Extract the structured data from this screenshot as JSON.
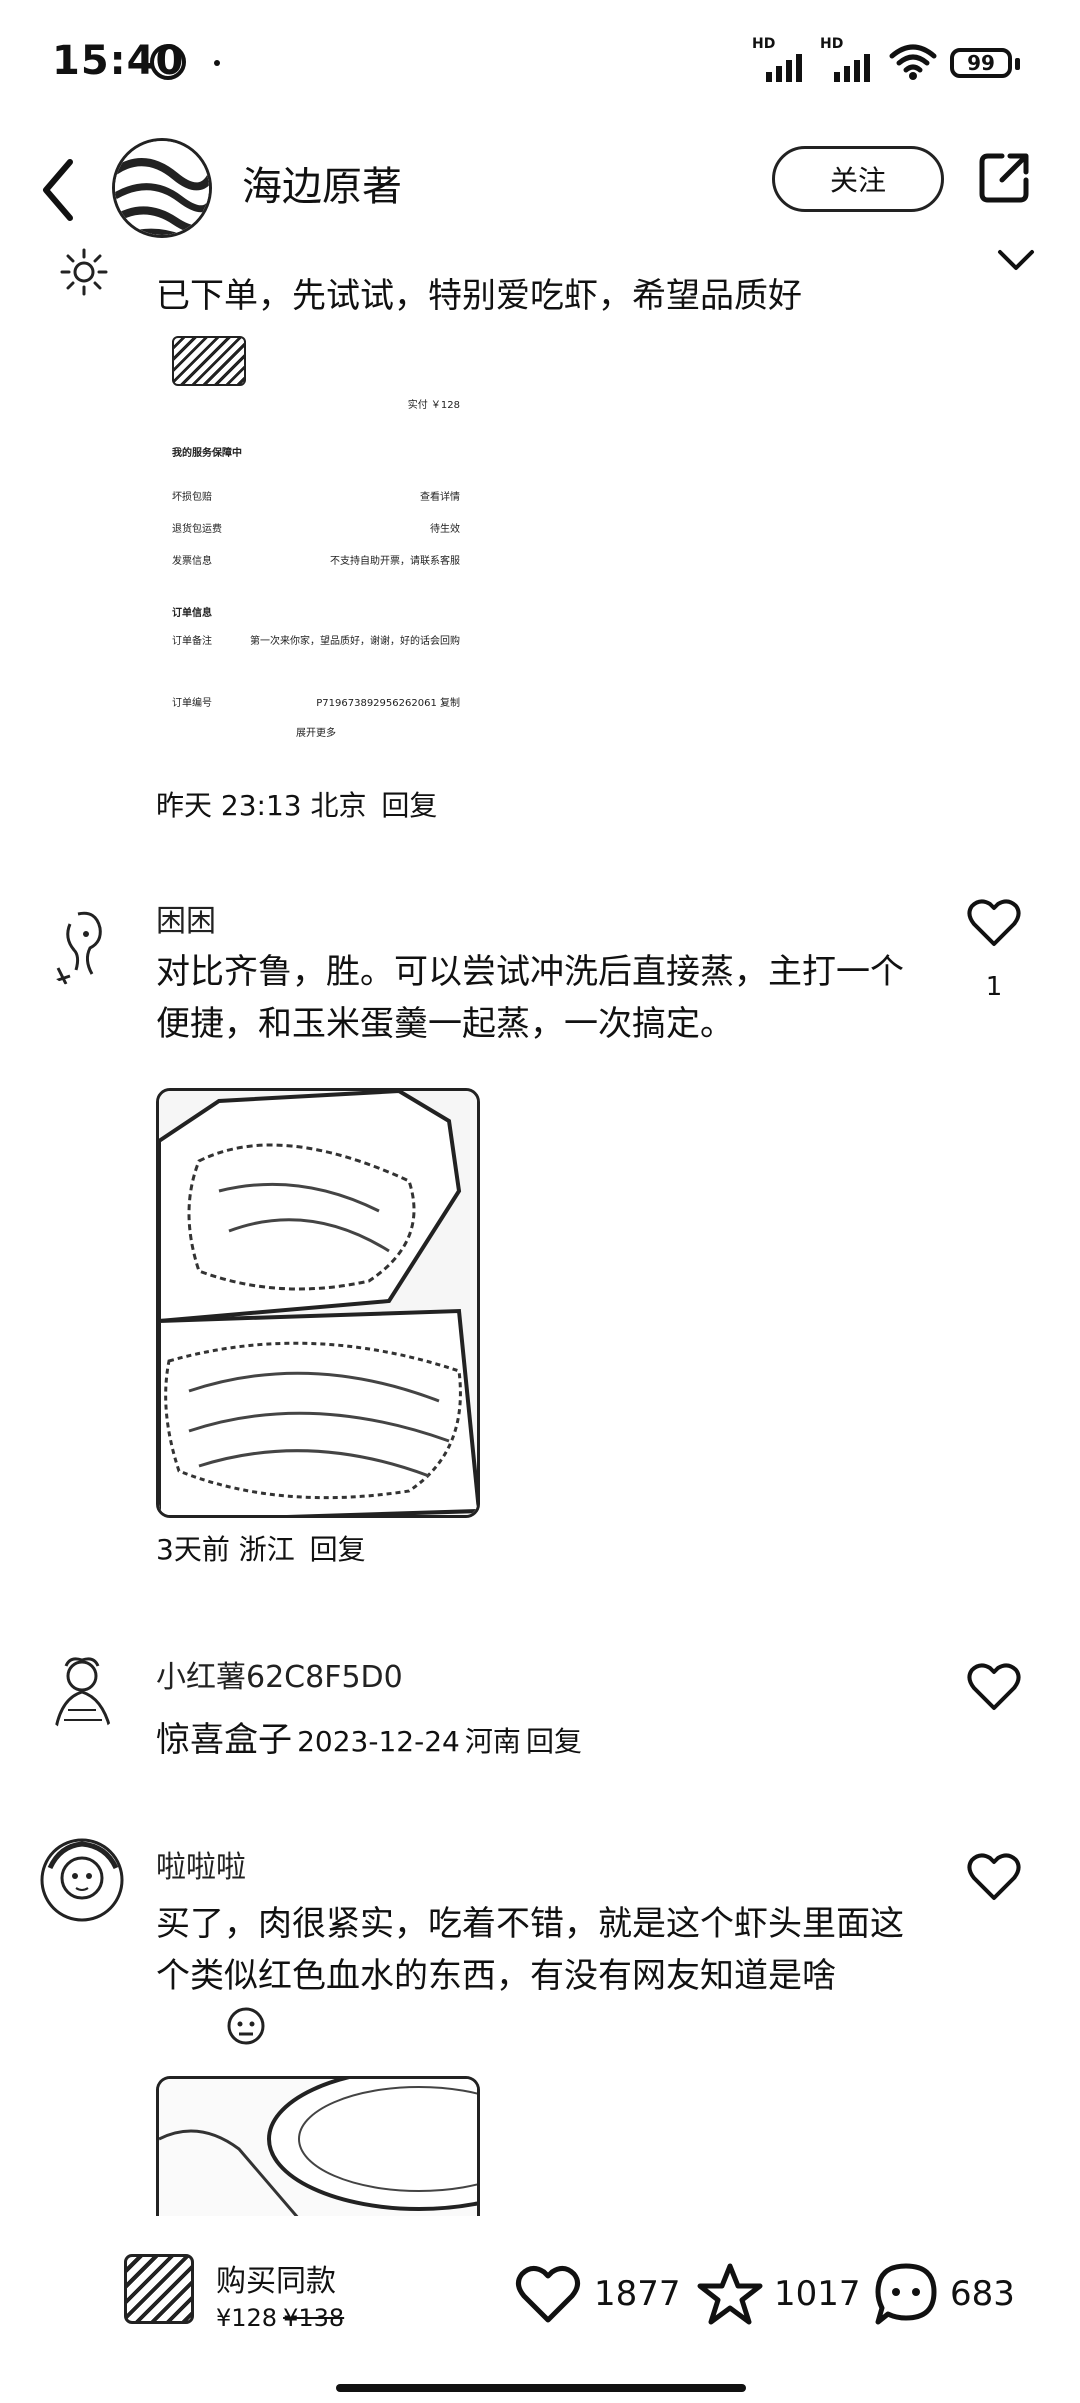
{
  "status_bar": {
    "time": "15:40",
    "signal_label": "HD",
    "battery": "99"
  },
  "header": {
    "author_name": "海边原著",
    "follow_label": "关注"
  },
  "comments": [
    {
      "text": "已下单，先试试，特别爱吃虾，希望品质好",
      "time": "昨天 23:13",
      "location": "北京",
      "reply_label": "回复",
      "attachment": {
        "paid": "实付 ￥128",
        "service_title": "我的服务保障中",
        "rows": [
          {
            "label": "坏损包赔",
            "value": "查看详情"
          },
          {
            "label": "退货包运费",
            "value": "待生效"
          },
          {
            "label": "发票信息",
            "value": "不支持自助开票，请联系客服"
          }
        ],
        "order_title": "订单信息",
        "remark_label": "订单备注",
        "remark_value": "第一次来你家，望品质好，谢谢，好的话会回购",
        "order_no_label": "订单编号",
        "order_no": "P719673892956262061",
        "copy_label": "复制",
        "expand_label": "展开更多"
      }
    },
    {
      "username": "困困",
      "text": "对比齐鲁，胜。可以尝试冲洗后直接蒸，主打一个便捷，和玉米蛋羹一起蒸，一次搞定。",
      "time": "3天前",
      "location": "浙江",
      "reply_label": "回复",
      "likes": "1"
    },
    {
      "username": "小红薯62C8F5D0",
      "text": "惊喜盒子",
      "time": "2023-12-24",
      "location": "河南",
      "reply_label": "回复",
      "likes": ""
    },
    {
      "username": "啦啦啦",
      "text": "买了，肉很紧实，吃着不错，就是这个虾头里面这个类似红色血水的东西，有没有网友知道是啥",
      "likes": ""
    }
  ],
  "bottom_bar": {
    "buy_label": "购买同款",
    "price": "¥128",
    "original_price": "¥138",
    "like_count": "1877",
    "star_count": "1017",
    "comment_count": "683"
  }
}
